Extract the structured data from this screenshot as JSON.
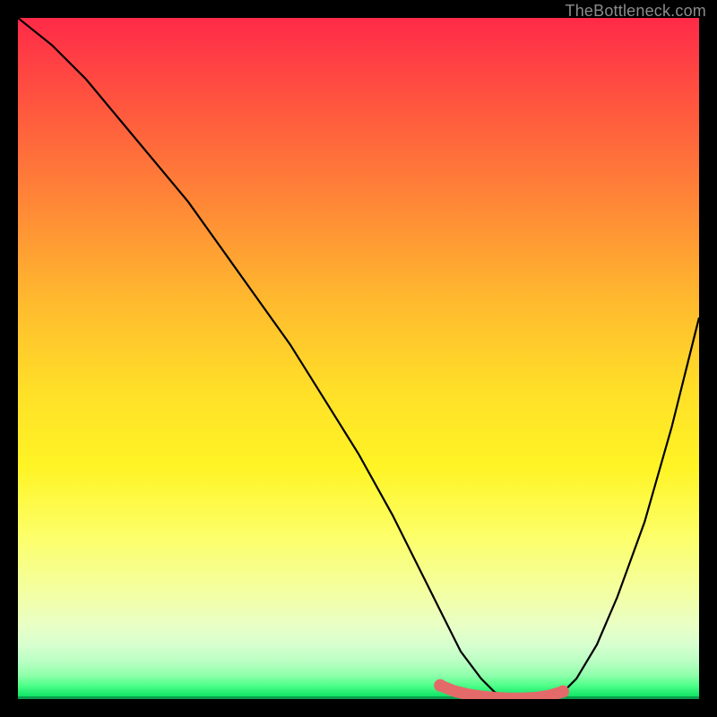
{
  "attribution": "TheBottleneck.com",
  "colors": {
    "background": "#000000",
    "gradient_top": "#ff2a48",
    "gradient_mid": "#ffe028",
    "gradient_bottom": "#17e86a",
    "curve": "#000000",
    "marker": "#e46a6a",
    "text": "#8b8b8b"
  },
  "chart_data": {
    "type": "line",
    "title": "",
    "xlabel": "",
    "ylabel": "",
    "xlim": [
      0,
      100
    ],
    "ylim": [
      0,
      100
    ],
    "grid": false,
    "legend": false,
    "annotations": [],
    "series": [
      {
        "name": "bottleneck-curve",
        "x": [
          0,
          5,
          10,
          15,
          20,
          25,
          30,
          35,
          40,
          45,
          50,
          55,
          60,
          62,
          65,
          68,
          70,
          72,
          74,
          76,
          78,
          80,
          82,
          85,
          88,
          92,
          96,
          100
        ],
        "y": [
          100,
          96,
          91,
          85,
          79,
          73,
          66,
          59,
          52,
          44,
          36,
          27,
          17,
          13,
          7,
          3,
          1,
          0,
          0,
          0,
          0,
          1,
          3,
          8,
          15,
          26,
          40,
          56
        ]
      }
    ],
    "marker_segment": {
      "name": "optimal-range",
      "x": [
        62,
        64,
        66,
        68,
        70,
        72,
        74,
        76,
        78,
        80
      ],
      "y": [
        2,
        1.2,
        0.7,
        0.4,
        0.2,
        0.1,
        0.1,
        0.2,
        0.5,
        1.1
      ]
    }
  }
}
